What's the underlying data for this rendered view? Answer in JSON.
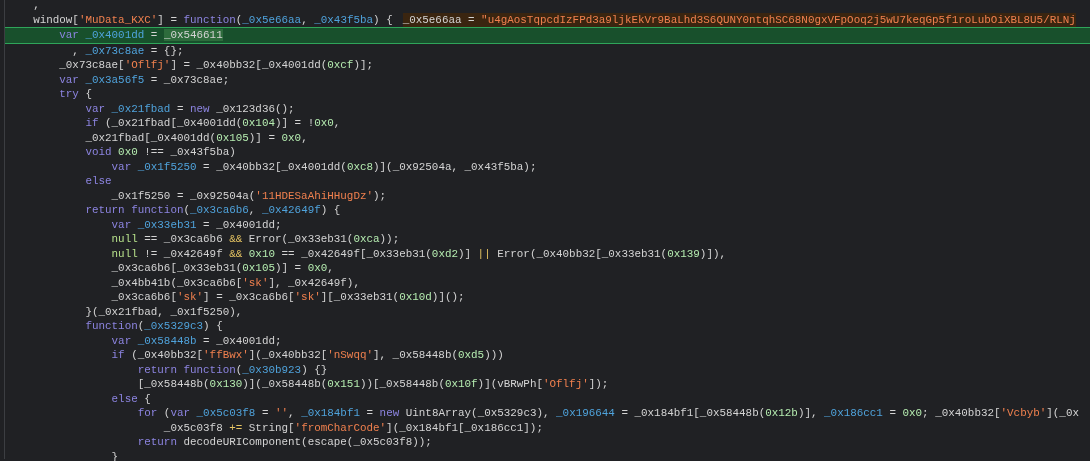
{
  "editor": {
    "lines": [
      {
        "highlighted": false,
        "tokens": [
          {
            "kind": "plain",
            "text": "    ,"
          }
        ]
      },
      {
        "highlighted": false,
        "tokens": [
          {
            "kind": "plain",
            "text": "    window["
          },
          {
            "kind": "string",
            "text": "'MuData_KXC'"
          },
          {
            "kind": "plain",
            "text": "] = "
          },
          {
            "kind": "keyword",
            "text": "function"
          },
          {
            "kind": "plain",
            "text": "("
          },
          {
            "kind": "declaration",
            "text": "_0x5e66aa"
          },
          {
            "kind": "plain",
            "text": ", "
          },
          {
            "kind": "declaration",
            "text": "_0x43f5ba"
          },
          {
            "kind": "plain",
            "text": ") {"
          }
        ],
        "hint": [
          {
            "kind": "plain",
            "text": "_0x5e66aa = "
          },
          {
            "kind": "string",
            "text": "\"u4gAosTqpcdIzFPd3a9ljkEkVr9BaLhd3S6QUNY0ntqhSC68N0gxVFpOoq2j5wU7keqGp5f1roLubOiXBL8U5/RLNj"
          }
        ]
      },
      {
        "highlighted": true,
        "tokens": [
          {
            "kind": "keyword",
            "text": "        var "
          },
          {
            "kind": "declaration",
            "text": "_0x4001dd"
          },
          {
            "kind": "plain",
            "text": " = "
          },
          {
            "kind": "match",
            "text": "_0x546611"
          }
        ]
      },
      {
        "highlighted": false,
        "tokens": [
          {
            "kind": "plain",
            "text": "          , "
          },
          {
            "kind": "declaration",
            "text": "_0x73c8ae"
          },
          {
            "kind": "plain",
            "text": " = {};"
          }
        ]
      },
      {
        "highlighted": false,
        "tokens": [
          {
            "kind": "plain",
            "text": "        _0x73c8ae["
          },
          {
            "kind": "string",
            "text": "'Oflfj'"
          },
          {
            "kind": "plain",
            "text": "] = _0x40bb32[_0x4001dd("
          },
          {
            "kind": "number",
            "text": "0xcf"
          },
          {
            "kind": "plain",
            "text": ")];"
          }
        ]
      },
      {
        "highlighted": false,
        "tokens": [
          {
            "kind": "keyword",
            "text": "        var "
          },
          {
            "kind": "declaration",
            "text": "_0x3a56f5"
          },
          {
            "kind": "plain",
            "text": " = _0x73c8ae;"
          }
        ]
      },
      {
        "highlighted": false,
        "tokens": [
          {
            "kind": "keyword",
            "text": "        try"
          },
          {
            "kind": "plain",
            "text": " {"
          }
        ]
      },
      {
        "highlighted": false,
        "tokens": [
          {
            "kind": "keyword",
            "text": "            var "
          },
          {
            "kind": "declaration",
            "text": "_0x21fbad"
          },
          {
            "kind": "plain",
            "text": " = "
          },
          {
            "kind": "keyword",
            "text": "new"
          },
          {
            "kind": "plain",
            "text": " _0x123d36();"
          }
        ]
      },
      {
        "highlighted": false,
        "tokens": [
          {
            "kind": "keyword",
            "text": "            if"
          },
          {
            "kind": "plain",
            "text": " (_0x21fbad[_0x4001dd("
          },
          {
            "kind": "number",
            "text": "0x104"
          },
          {
            "kind": "plain",
            "text": ")] = !"
          },
          {
            "kind": "number",
            "text": "0x0"
          },
          {
            "kind": "plain",
            "text": ","
          }
        ]
      },
      {
        "highlighted": false,
        "tokens": [
          {
            "kind": "plain",
            "text": "            _0x21fbad[_0x4001dd("
          },
          {
            "kind": "number",
            "text": "0x105"
          },
          {
            "kind": "plain",
            "text": ")] = "
          },
          {
            "kind": "number",
            "text": "0x0"
          },
          {
            "kind": "plain",
            "text": ","
          }
        ]
      },
      {
        "highlighted": false,
        "tokens": [
          {
            "kind": "keyword",
            "text": "            void "
          },
          {
            "kind": "number",
            "text": "0x0"
          },
          {
            "kind": "plain",
            "text": " !== _0x43f5ba)"
          }
        ]
      },
      {
        "highlighted": false,
        "tokens": [
          {
            "kind": "keyword",
            "text": "                var "
          },
          {
            "kind": "declaration",
            "text": "_0x1f5250"
          },
          {
            "kind": "plain",
            "text": " = _0x40bb32[_0x4001dd("
          },
          {
            "kind": "number",
            "text": "0xc8"
          },
          {
            "kind": "plain",
            "text": ")](_0x92504a, _0x43f5ba);"
          }
        ]
      },
      {
        "highlighted": false,
        "tokens": [
          {
            "kind": "keyword",
            "text": "            else"
          }
        ]
      },
      {
        "highlighted": false,
        "tokens": [
          {
            "kind": "plain",
            "text": "                _0x1f5250 = _0x92504a("
          },
          {
            "kind": "string",
            "text": "'11HDESaAhiHHugDz'"
          },
          {
            "kind": "plain",
            "text": ");"
          }
        ]
      },
      {
        "highlighted": false,
        "tokens": [
          {
            "kind": "keyword",
            "text": "            return function"
          },
          {
            "kind": "plain",
            "text": "("
          },
          {
            "kind": "declaration",
            "text": "_0x3ca6b6"
          },
          {
            "kind": "plain",
            "text": ", "
          },
          {
            "kind": "declaration",
            "text": "_0x42649f"
          },
          {
            "kind": "plain",
            "text": ") {"
          }
        ]
      },
      {
        "highlighted": false,
        "tokens": [
          {
            "kind": "keyword",
            "text": "                var "
          },
          {
            "kind": "declaration",
            "text": "_0x33eb31"
          },
          {
            "kind": "plain",
            "text": " = _0x4001dd;"
          }
        ]
      },
      {
        "highlighted": false,
        "tokens": [
          {
            "kind": "literal",
            "text": "                null"
          },
          {
            "kind": "plain",
            "text": " == _0x3ca6b6 "
          },
          {
            "kind": "operator",
            "text": "&&"
          },
          {
            "kind": "plain",
            "text": " Error(_0x33eb31("
          },
          {
            "kind": "number",
            "text": "0xca"
          },
          {
            "kind": "plain",
            "text": "));"
          }
        ]
      },
      {
        "highlighted": false,
        "tokens": [
          {
            "kind": "literal",
            "text": "                null"
          },
          {
            "kind": "plain",
            "text": " != _0x42649f "
          },
          {
            "kind": "operator",
            "text": "&& "
          },
          {
            "kind": "number",
            "text": "0x10"
          },
          {
            "kind": "plain",
            "text": " == _0x42649f[_0x33eb31("
          },
          {
            "kind": "number",
            "text": "0xd2"
          },
          {
            "kind": "plain",
            "text": ")] "
          },
          {
            "kind": "operator",
            "text": "||"
          },
          {
            "kind": "plain",
            "text": " Error(_0x40bb32[_0x33eb31("
          },
          {
            "kind": "number",
            "text": "0x139"
          },
          {
            "kind": "plain",
            "text": ")]),"
          }
        ]
      },
      {
        "highlighted": false,
        "tokens": [
          {
            "kind": "plain",
            "text": "                _0x3ca6b6[_0x33eb31("
          },
          {
            "kind": "number",
            "text": "0x105"
          },
          {
            "kind": "plain",
            "text": ")] = "
          },
          {
            "kind": "number",
            "text": "0x0"
          },
          {
            "kind": "plain",
            "text": ","
          }
        ]
      },
      {
        "highlighted": false,
        "tokens": [
          {
            "kind": "plain",
            "text": "                _0x4bb41b(_0x3ca6b6["
          },
          {
            "kind": "string",
            "text": "'sk'"
          },
          {
            "kind": "plain",
            "text": "], _0x42649f),"
          }
        ]
      },
      {
        "highlighted": false,
        "tokens": [
          {
            "kind": "plain",
            "text": "                _0x3ca6b6["
          },
          {
            "kind": "string",
            "text": "'sk'"
          },
          {
            "kind": "plain",
            "text": "] = _0x3ca6b6["
          },
          {
            "kind": "string",
            "text": "'sk'"
          },
          {
            "kind": "plain",
            "text": "][_0x33eb31("
          },
          {
            "kind": "number",
            "text": "0x10d"
          },
          {
            "kind": "plain",
            "text": ")]();"
          }
        ]
      },
      {
        "highlighted": false,
        "tokens": [
          {
            "kind": "plain",
            "text": "            }(_0x21fbad, _0x1f5250),"
          }
        ]
      },
      {
        "highlighted": false,
        "tokens": [
          {
            "kind": "keyword",
            "text": "            function"
          },
          {
            "kind": "plain",
            "text": "("
          },
          {
            "kind": "declaration",
            "text": "_0x5329c3"
          },
          {
            "kind": "plain",
            "text": ") {"
          }
        ]
      },
      {
        "highlighted": false,
        "tokens": [
          {
            "kind": "keyword",
            "text": "                var "
          },
          {
            "kind": "declaration",
            "text": "_0x58448b"
          },
          {
            "kind": "plain",
            "text": " = _0x4001dd;"
          }
        ]
      },
      {
        "highlighted": false,
        "tokens": [
          {
            "kind": "keyword",
            "text": "                if"
          },
          {
            "kind": "plain",
            "text": " (_0x40bb32["
          },
          {
            "kind": "string",
            "text": "'ffBwx'"
          },
          {
            "kind": "plain",
            "text": "](_0x40bb32["
          },
          {
            "kind": "string",
            "text": "'nSwqq'"
          },
          {
            "kind": "plain",
            "text": "], _0x58448b("
          },
          {
            "kind": "number",
            "text": "0xd5"
          },
          {
            "kind": "plain",
            "text": ")))"
          }
        ]
      },
      {
        "highlighted": false,
        "tokens": [
          {
            "kind": "keyword",
            "text": "                    return function"
          },
          {
            "kind": "plain",
            "text": "("
          },
          {
            "kind": "declaration",
            "text": "_0x30b923"
          },
          {
            "kind": "plain",
            "text": ") {}"
          }
        ]
      },
      {
        "highlighted": false,
        "tokens": [
          {
            "kind": "plain",
            "text": "                    [_0x58448b("
          },
          {
            "kind": "number",
            "text": "0x130"
          },
          {
            "kind": "plain",
            "text": ")](_0x58448b("
          },
          {
            "kind": "number",
            "text": "0x151"
          },
          {
            "kind": "plain",
            "text": "))[_0x58448b("
          },
          {
            "kind": "number",
            "text": "0x10f"
          },
          {
            "kind": "plain",
            "text": ")](vBRwPh["
          },
          {
            "kind": "string",
            "text": "'Oflfj'"
          },
          {
            "kind": "plain",
            "text": "]);"
          }
        ]
      },
      {
        "highlighted": false,
        "tokens": [
          {
            "kind": "keyword",
            "text": "                else"
          },
          {
            "kind": "plain",
            "text": " {"
          }
        ]
      },
      {
        "highlighted": false,
        "tokens": [
          {
            "kind": "keyword",
            "text": "                    for"
          },
          {
            "kind": "plain",
            "text": " ("
          },
          {
            "kind": "keyword",
            "text": "var "
          },
          {
            "kind": "declaration",
            "text": "_0x5c03f8"
          },
          {
            "kind": "plain",
            "text": " = "
          },
          {
            "kind": "string",
            "text": "''"
          },
          {
            "kind": "plain",
            "text": ", "
          },
          {
            "kind": "declaration",
            "text": "_0x184bf1"
          },
          {
            "kind": "plain",
            "text": " = "
          },
          {
            "kind": "keyword",
            "text": "new"
          },
          {
            "kind": "plain",
            "text": " Uint8Array(_0x5329c3), "
          },
          {
            "kind": "declaration",
            "text": "_0x196644"
          },
          {
            "kind": "plain",
            "text": " = _0x184bf1[_0x58448b("
          },
          {
            "kind": "number",
            "text": "0x12b"
          },
          {
            "kind": "plain",
            "text": ")], "
          },
          {
            "kind": "declaration",
            "text": "_0x186cc1"
          },
          {
            "kind": "plain",
            "text": " = "
          },
          {
            "kind": "number",
            "text": "0x0"
          },
          {
            "kind": "plain",
            "text": "; _0x40bb32["
          },
          {
            "kind": "string",
            "text": "'Vcbyb'"
          },
          {
            "kind": "plain",
            "text": "](_0x"
          }
        ]
      },
      {
        "highlighted": false,
        "tokens": [
          {
            "kind": "plain",
            "text": "                        _0x5c03f8 "
          },
          {
            "kind": "operator",
            "text": "+="
          },
          {
            "kind": "plain",
            "text": " String["
          },
          {
            "kind": "string",
            "text": "'fromCharCode'"
          },
          {
            "kind": "plain",
            "text": "](_0x184bf1[_0x186cc1]);"
          }
        ]
      },
      {
        "highlighted": false,
        "tokens": [
          {
            "kind": "keyword",
            "text": "                    return"
          },
          {
            "kind": "plain",
            "text": " decodeURIComponent(escape(_0x5c03f8));"
          }
        ]
      },
      {
        "highlighted": false,
        "tokens": [
          {
            "kind": "plain",
            "text": "                }"
          }
        ]
      }
    ]
  }
}
